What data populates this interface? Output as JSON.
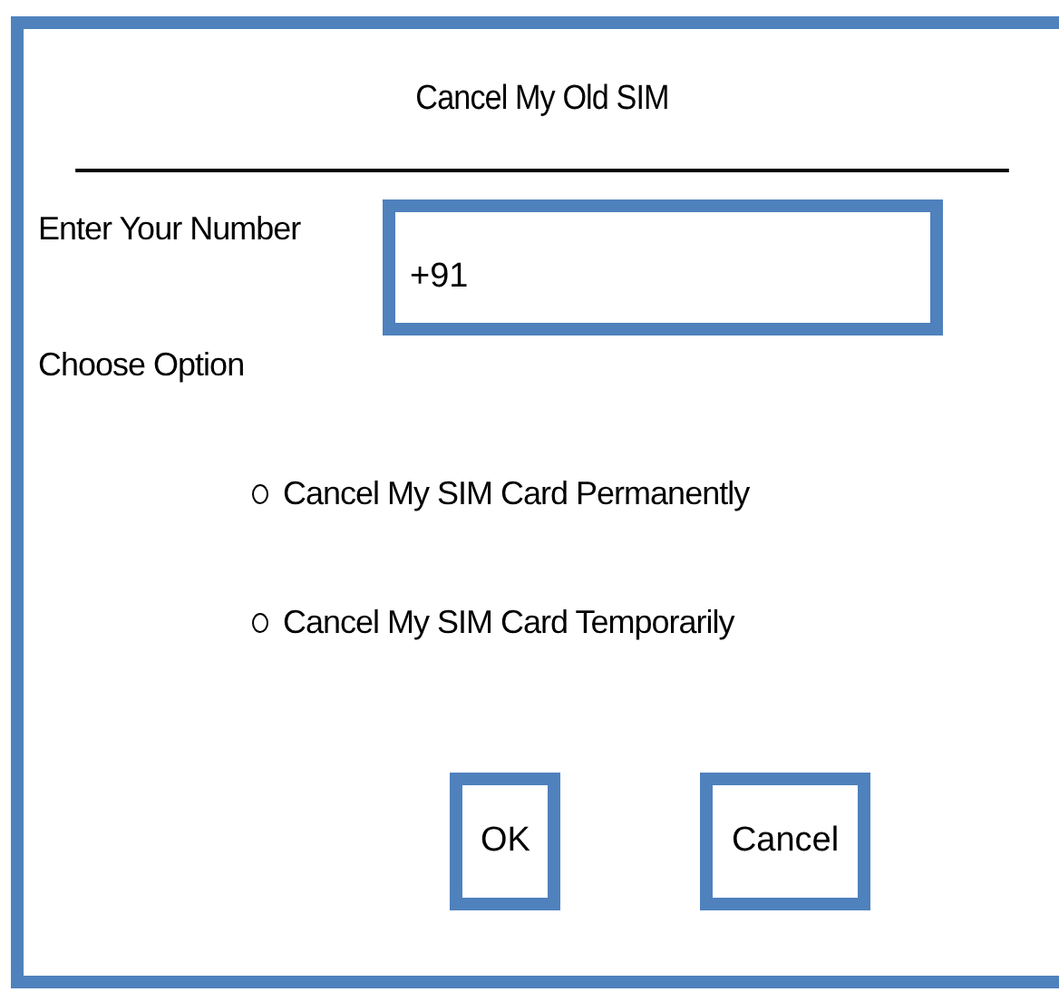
{
  "window": {
    "title": "Cancel My Old SIM"
  },
  "number": {
    "label": "Enter Your Number",
    "value": "+91"
  },
  "options": {
    "label": "Choose Option",
    "items": [
      {
        "label": "Cancel My SIM Card Permanently",
        "selected": false
      },
      {
        "label": "Cancel My SIM Card Temporarily",
        "selected": false
      }
    ]
  },
  "buttons": [
    "OK",
    "Cancel"
  ]
}
